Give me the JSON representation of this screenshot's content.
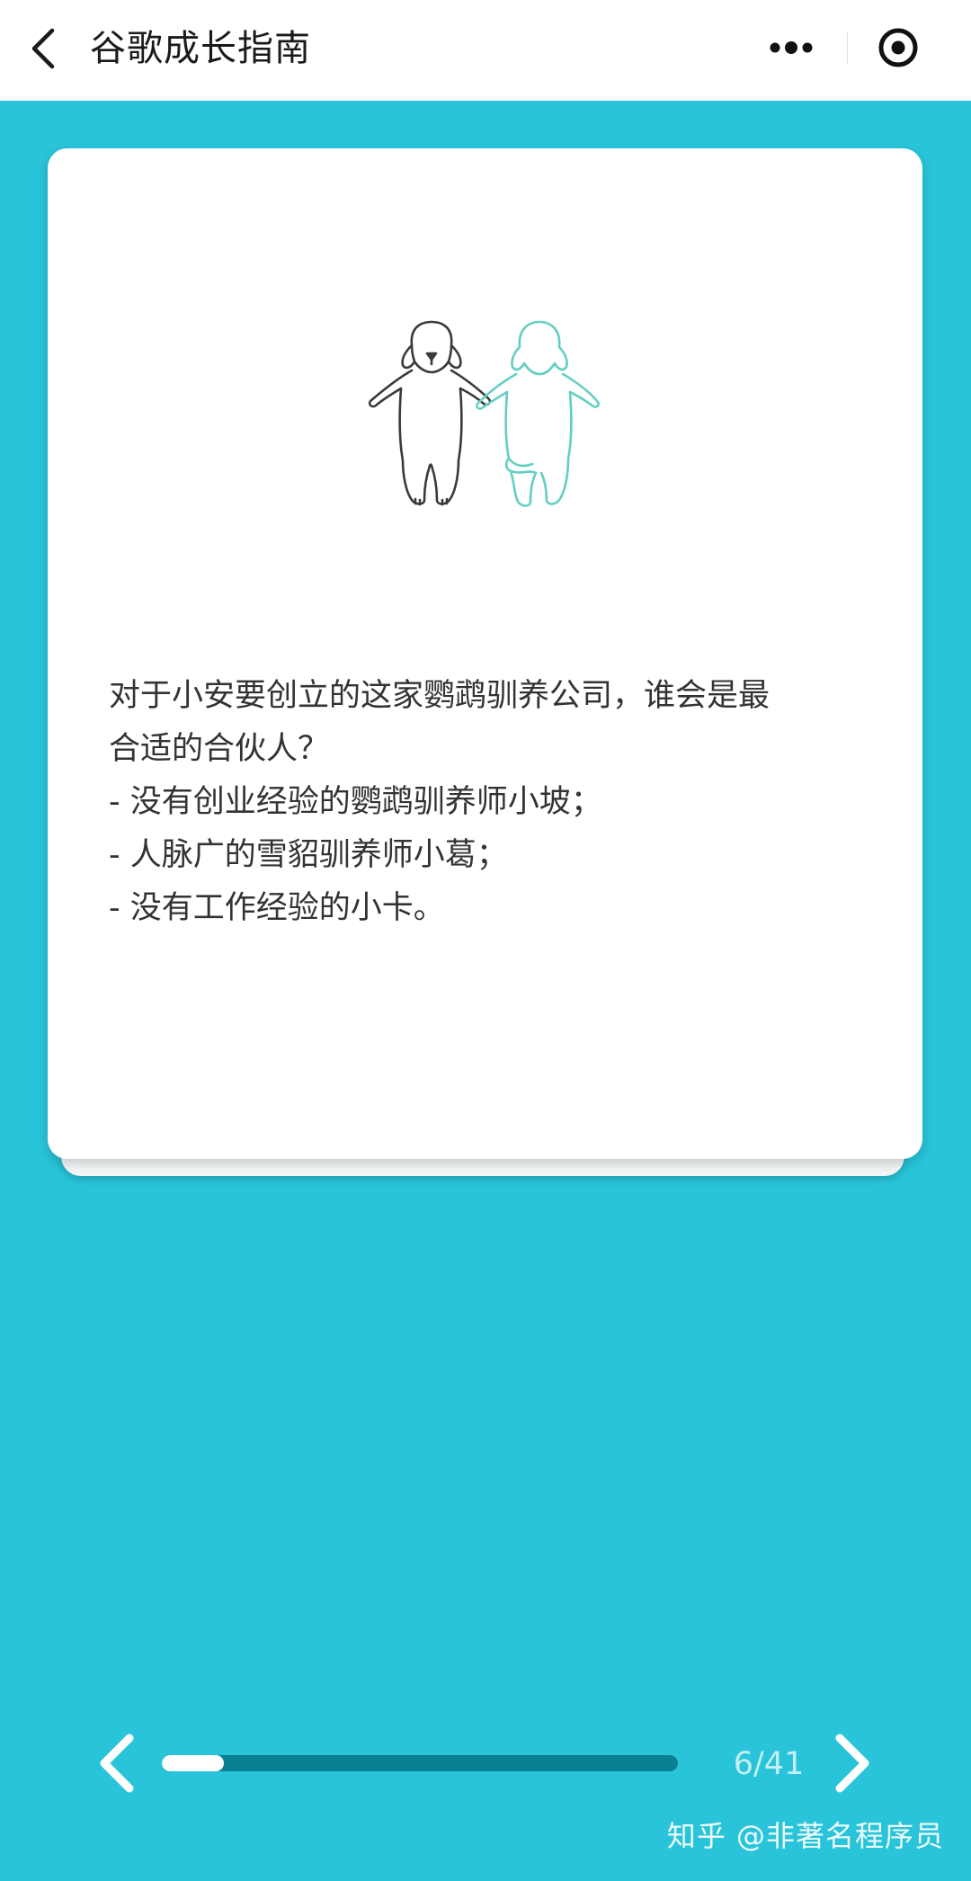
{
  "header": {
    "title": "谷歌成长指南",
    "back_icon": "chevron-left-icon",
    "more_icon": "more-dots-icon",
    "close_icon": "target-close-icon"
  },
  "card": {
    "illustration_icon": "two-dogs-illustration",
    "question_lines": [
      "对于小安要创立的这家鹦鹉驯养公司，谁会是最",
      "合适的合伙人？",
      "- 没有创业经验的鹦鹉驯养师小坡；",
      "- 人脉广的雪貂驯养师小葛；",
      "- 没有工作经验的小卡。"
    ]
  },
  "navigation": {
    "prev_icon": "chevron-left-icon",
    "next_icon": "chevron-right-icon",
    "page_indicator": "6/41",
    "progress": 0.12
  },
  "watermark": "知乎 @非著名程序员",
  "colors": {
    "background": "#29c4d9",
    "progress_track": "#0a8193",
    "progress_fill": "#ffffff",
    "card": "#ffffff",
    "dog_outline": "#3a3a3a",
    "dog_teal": "#62cfc2"
  }
}
